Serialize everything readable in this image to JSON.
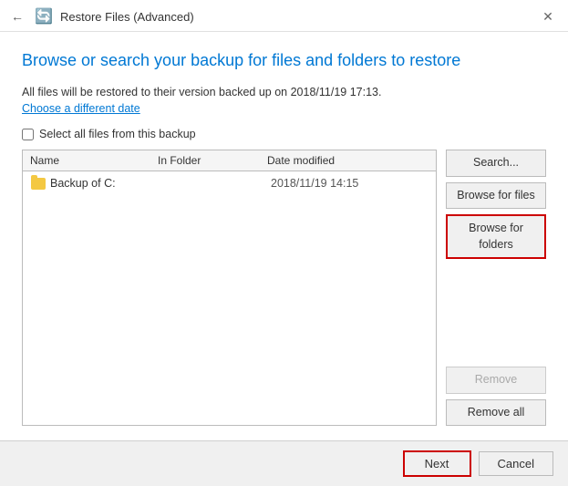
{
  "titleBar": {
    "title": "Restore Files (Advanced)",
    "closeLabel": "✕"
  },
  "heading": "Browse or search your backup for files and folders to restore",
  "infoText": "All files will be restored to their version backed up on 2018/11/19 17:13.",
  "linkText": "Choose a different date",
  "checkbox": {
    "label": "Select all files from this backup"
  },
  "table": {
    "columns": {
      "name": "Name",
      "inFolder": "In Folder",
      "dateModified": "Date modified"
    },
    "rows": [
      {
        "name": "Backup of C:",
        "folder": "",
        "date": "2018/11/19 14:15",
        "type": "folder"
      }
    ]
  },
  "sideButtons": {
    "search": "Search...",
    "browseFiles": "Browse for files",
    "browseFolders": "Browse for folders",
    "remove": "Remove",
    "removeAll": "Remove all"
  },
  "bottomBar": {
    "next": "Next",
    "cancel": "Cancel"
  }
}
